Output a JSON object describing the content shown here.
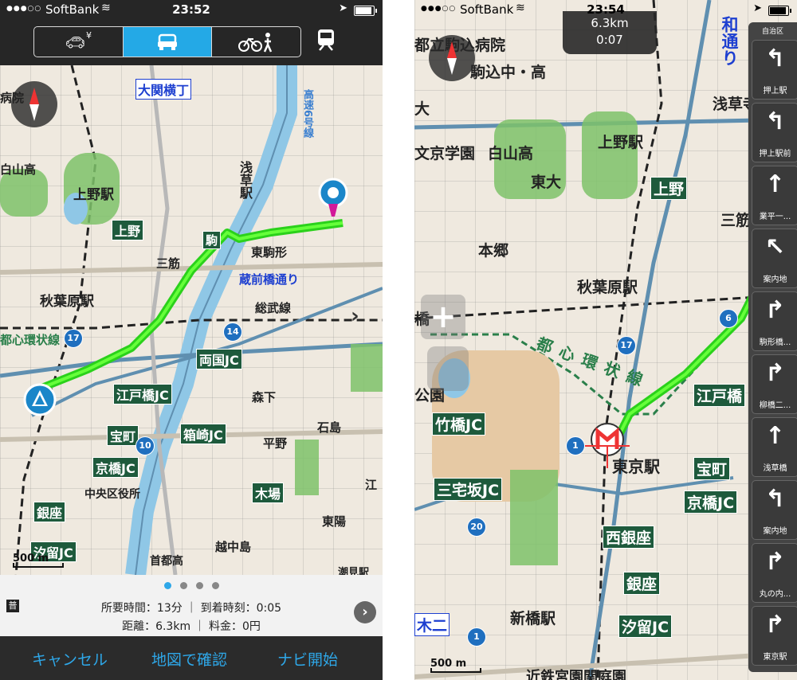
{
  "left": {
    "status": {
      "carrier": "SoftBank",
      "time": "23:52"
    },
    "modes": {
      "car_toll_yen": "¥"
    },
    "map": {
      "labels": {
        "oozeki": "大関横丁",
        "asakusa_v": "浅草駅",
        "ueno_st": "上野駅",
        "ueno": "上野",
        "komagata": "東駒形",
        "kuramae": "蔵前橋通り",
        "sansuji": "三筋",
        "akihabara": "秋葉原駅",
        "sobu": "総武線",
        "ryogoku": "両国JC",
        "edobashi": "江戸橋JC",
        "morishita": "森下",
        "takaracho": "宝町",
        "hakozaki": "箱崎JC",
        "kyobashi": "京橋JC",
        "chuo": "中央区役所",
        "hirano": "平野",
        "ishijima": "石島",
        "kiba": "木場",
        "ginza": "銀座",
        "shiodome": "汐留JC",
        "higashi": "東陽",
        "etchujima": "越中島",
        "shutoko": "首都高",
        "shiomi": "潮見駅",
        "shutoko6": "高速6号線",
        "tozai": "都心環状線",
        "hakusan": "白山高",
        "hospital": "病院",
        "koma": "駒",
        "kouto": "江",
        "tsuki": "普"
      },
      "scale": "500 m"
    },
    "info": {
      "badge": "普",
      "line1": "所要時間：13分 ｜ 到着時刻：0:05",
      "line2": "距離：6.3km ｜ 料金：0円"
    },
    "actions": {
      "cancel": "キャンセル",
      "confirm": "地図で確認",
      "start": "ナビ開始"
    }
  },
  "right": {
    "status": {
      "carrier": "SoftBank",
      "time": "23:54"
    },
    "trip": {
      "distance": "6.3km",
      "remaining": "0:07"
    },
    "map": {
      "labels": {
        "komagome_hosp": "都立駒込病院",
        "komagome_h": "駒込中・高",
        "bunkyo": "文京学園",
        "shirakawa": "白山高",
        "todai": "東大",
        "ueno_st": "上野駅",
        "ueno": "上野",
        "hongo": "本郷",
        "akihabara": "秋葉原駅",
        "sansuji": "三筋",
        "dai": "大",
        "ichikawa": "橋",
        "tozai": "都心環状線",
        "kouen": "公園",
        "takebashi": "竹橋JC",
        "miyakezaka": "三宅坂JC",
        "tokyo_st": "東京駅",
        "edobashi": "江戸橋",
        "takaracho": "宝町",
        "kyobashi": "京橋JC",
        "nishiginza": "西銀座",
        "ginza": "銀座",
        "shinbashi": "新橋駅",
        "shiodome": "汐留JC",
        "kiji": "木二",
        "wa": "和通り",
        "asakusa": "浅草寺",
        "bottom": "近鉄宮園関庭園"
      },
      "scale": "500 m"
    },
    "turn_panel": {
      "top": "自治区",
      "turns": [
        {
          "label": "押上駅",
          "arrow": "↰"
        },
        {
          "label": "押上駅前",
          "arrow": "↰"
        },
        {
          "label": "業平一...",
          "arrow": "↑"
        },
        {
          "label": "案内地",
          "arrow": "↖"
        },
        {
          "label": "駒形橋...",
          "arrow": "↱"
        },
        {
          "label": "柳橋二...",
          "arrow": "↱"
        },
        {
          "label": "浅草橋",
          "arrow": "↑"
        },
        {
          "label": "案内地",
          "arrow": "↰"
        },
        {
          "label": "丸の内...",
          "arrow": "↱"
        },
        {
          "label": "東京駅",
          "arrow": "↱"
        }
      ]
    }
  }
}
